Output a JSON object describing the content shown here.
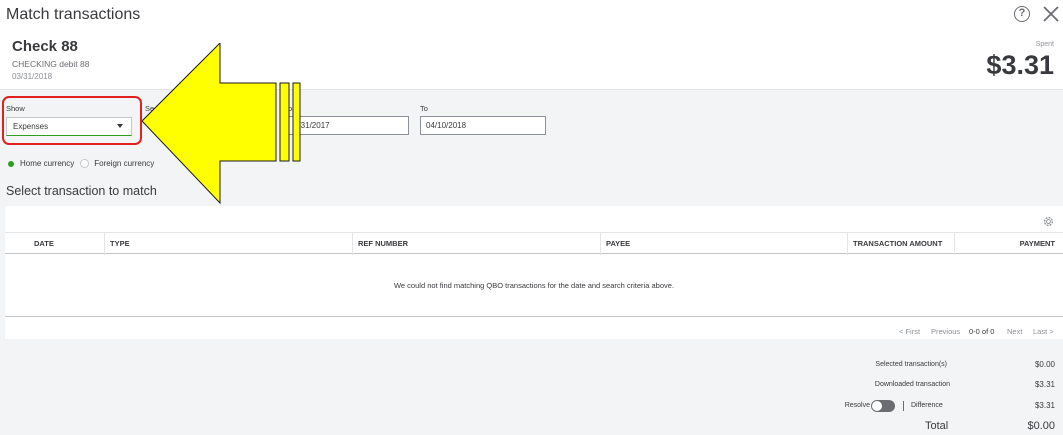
{
  "window": {
    "title": "Match transactions",
    "help_icon": "?"
  },
  "transaction": {
    "title": "Check 88",
    "subtitle": "CHECKING debit 88",
    "date": "03/31/2018",
    "spent_label": "Spent",
    "spent_amount": "$3.31"
  },
  "filters": {
    "show_label": "Show",
    "show_value": "Expenses",
    "search_label": "Sea",
    "from_label_partial": "o",
    "from_value": "2/31/2017",
    "to_label": "To",
    "to_value": "04/10/2018",
    "currency_home": "Home currency",
    "currency_foreign": "Foreign currency"
  },
  "section": {
    "title": "Select transaction to match"
  },
  "table": {
    "columns": [
      "DATE",
      "TYPE",
      "REF NUMBER",
      "PAYEE",
      "TRANSACTION AMOUNT",
      "PAYMENT"
    ],
    "empty_message": "We could not find matching QBO transactions for the date and search criteria above."
  },
  "pager": {
    "first": "< First",
    "previous": "Previous",
    "range": "0-0 of 0",
    "next": "Next",
    "last": "Last >"
  },
  "summary": {
    "selected_label": "Selected transaction(s)",
    "selected_value": "$0.00",
    "downloaded_label": "Downloaded transaction",
    "downloaded_value": "$3.31",
    "resolve_label": "Resolve",
    "difference_label": "Difference",
    "difference_value": "$3.31",
    "total_label": "Total",
    "total_value": "$0.00"
  },
  "colors": {
    "accent_green": "#2ca01c",
    "highlight_red": "#e32020",
    "arrow_yellow": "#ffff00"
  }
}
